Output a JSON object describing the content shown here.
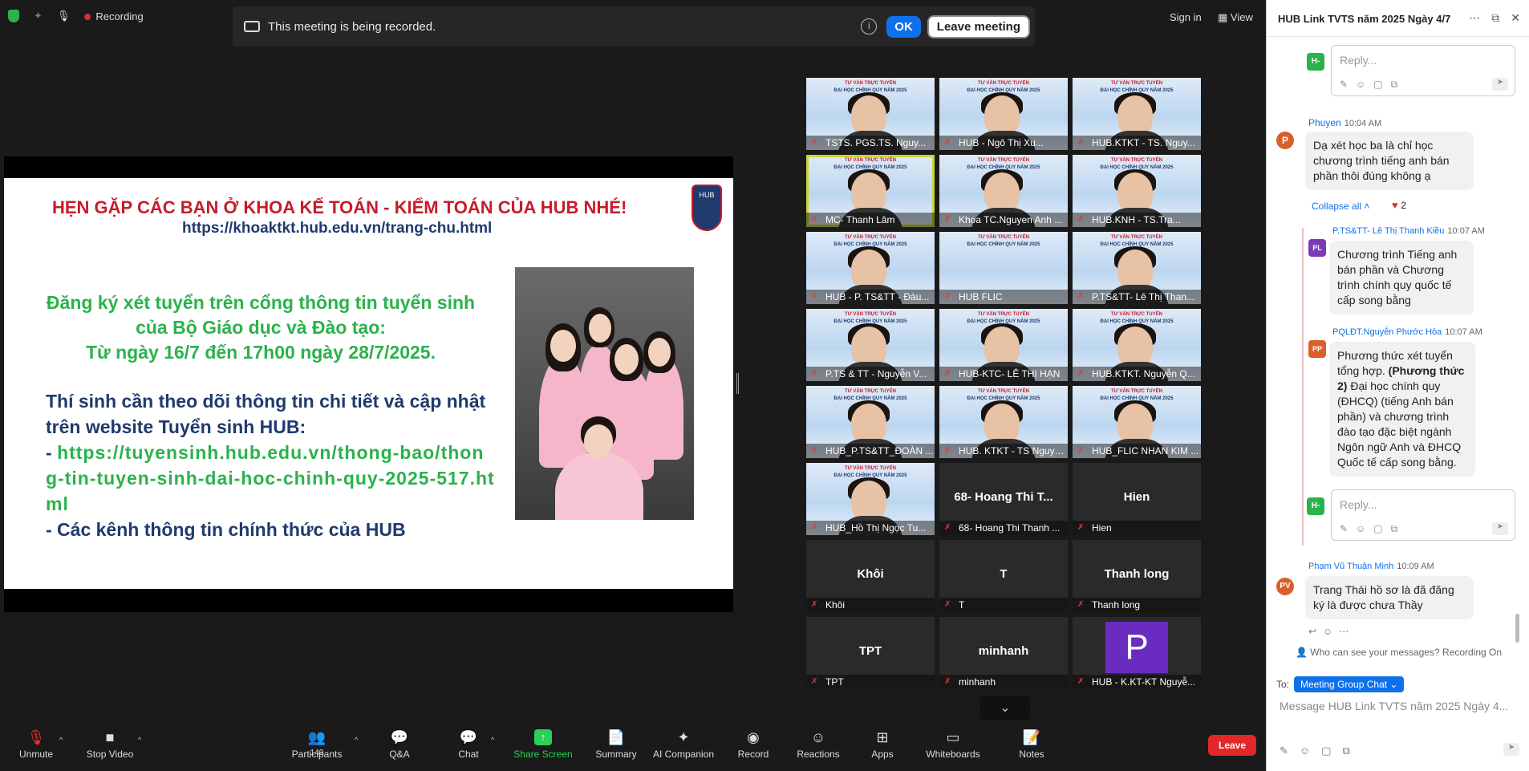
{
  "topbar": {
    "recording_label": "Recording",
    "banner_message": "This meeting is being recorded.",
    "ok_label": "OK",
    "leave_meeting_label": "Leave meeting",
    "signin_label": "Sign in",
    "view_label": "View"
  },
  "slide": {
    "title": "HẸN GẶP CÁC BẠN Ở  KHOA KẾ TOÁN - KIỂM TOÁN CỦA HUB NHÉ!",
    "url": "https://khoaktkt.hub.edu.vn/trang-chu.html",
    "logo_text": "HUB",
    "reg_line1": "Đăng ký xét tuyển trên cổng thông tin tuyển sinh",
    "reg_line2": "của Bộ Giáo dục và Đào tạo:",
    "reg_line3": "Từ ngày 16/7 đến 17h00 ngày 28/7/2025.",
    "note_line1": "Thí sinh cần theo dõi thông tin chi tiết và cập nhật trên website Tuyển sinh HUB:",
    "link_prefix": " - ",
    "link": "https://tuyensinh.hub.edu.vn/thong-bao/thong-tin-tuyen-sinh-dai-hoc-chinh-quy-2025-517.html",
    "note_line3": " - Các kênh thông tin chính thức của HUB"
  },
  "thumb": {
    "head": "TƯ VẤN TRỰC TUYẾN",
    "sub": "ĐẠI HỌC CHÍNH QUY NĂM 2025"
  },
  "gallery": [
    {
      "name": "TSTS. PGS.TS. Nguy...",
      "type": "video",
      "active": false
    },
    {
      "name": "HUB - Ngô Thị Xu...",
      "type": "video",
      "active": false
    },
    {
      "name": "HUB.KTKT - TS. Nguy...",
      "type": "video",
      "active": false
    },
    {
      "name": "MC- Thanh Lâm",
      "type": "video",
      "active": true
    },
    {
      "name": "Khoa TC.Nguyen Anh ...",
      "type": "video",
      "active": false
    },
    {
      "name": "HUB.KNH - TS.Tra...",
      "type": "video",
      "active": false
    },
    {
      "name": "HUB - P. TS&TT - Đàu...",
      "type": "video",
      "active": false
    },
    {
      "name": "HUB FLIC",
      "type": "video",
      "active": false
    },
    {
      "name": "P.TS&TT- Lê Thị Than...",
      "type": "video",
      "active": false
    },
    {
      "name": "P.TS & TT - Nguyễn V...",
      "type": "video",
      "active": false
    },
    {
      "name": "HUB-KTC- LÊ THỊ HẠN",
      "type": "video",
      "active": false
    },
    {
      "name": "HUB.KTKT. Nguyễn Q...",
      "type": "video",
      "active": false
    },
    {
      "name": "HUB_P.TS&TT_ĐOÀN ...",
      "type": "video",
      "active": false
    },
    {
      "name": "HUB. KTKT - TS Nguyen ...",
      "type": "video",
      "active": false
    },
    {
      "name": "HUB_FLIC NHAN KIM ...",
      "type": "video",
      "active": false
    },
    {
      "name": "HUB_Hồ Thị Ngọc Tu...",
      "type": "video",
      "active": false
    },
    {
      "name": "68- Hoang Thi Thanh ...",
      "type": "name",
      "big": "68- Hoang Thi T...",
      "active": false
    },
    {
      "name": "Hien",
      "type": "name",
      "big": "Hien",
      "active": false
    },
    {
      "name": "Khôi",
      "type": "name",
      "big": "Khôi",
      "active": false
    },
    {
      "name": "T",
      "type": "name",
      "big": "T",
      "active": false
    },
    {
      "name": "Thanh long",
      "type": "name",
      "big": "Thanh long",
      "active": false
    },
    {
      "name": "TPT",
      "type": "name",
      "big": "TPT",
      "active": false
    },
    {
      "name": "minhanh",
      "type": "name",
      "big": "minhanh",
      "active": false
    },
    {
      "name": "HUB - K.KT-KT Nguyễ...",
      "type": "avatar",
      "big": "P",
      "active": false
    }
  ],
  "toolbar": {
    "unmute": "Unmute",
    "stop_video": "Stop Video",
    "participants": "Participants",
    "participants_count": "149",
    "qa": "Q&A",
    "chat": "Chat",
    "share_screen": "Share Screen",
    "summary": "Summary",
    "ai_companion": "AI Companion",
    "record": "Record",
    "reactions": "Reactions",
    "apps": "Apps",
    "whiteboards": "Whiteboards",
    "notes": "Notes",
    "leave": "Leave"
  },
  "chat": {
    "title": "HUB Link TVTS năm 2025 Ngày 4/7",
    "reply_placeholder": "Reply...",
    "messages": {
      "phuyen": {
        "initial": "P",
        "sender": "Phuyen",
        "time": "10:04 AM",
        "text": "Dạ xét học ba là chỉ học chương trình tiếng anh bán phần thôi đúng không ạ"
      },
      "collapse": "Collapse all",
      "heart_count": "2",
      "le_thi": {
        "initial": "PL",
        "sender": "P.TS&TT- Lê Thị Thanh Kiều",
        "time": "10:07 AM",
        "text": "Chương trình Tiếng anh bán phần và Chương trình chính quy quốc tế cấp song bằng"
      },
      "pqldt": {
        "initial": "PP",
        "sender": "PQLĐT.Nguyễn Phước Hòa",
        "time": "10:07 AM",
        "text_pre": "Phương thức xét tuyển tổng hợp. ",
        "text_bold": "(Phương thức 2)",
        "text_post": " Đại học chính quy (ĐHCQ) (tiếng Anh bán phần) và chương trình đào tạo đặc biệt ngành Ngôn ngữ Anh và ĐHCQ Quốc tế cấp song bằng."
      },
      "pham": {
        "initial": "PV",
        "sender": "Phạm Vũ Thuận Minh",
        "time": "10:09 AM",
        "text": "Trang Thái hồ sơ là đã đăng ký là được chưa Thầy"
      }
    },
    "who_can_see": "Who can see your messages? Recording On",
    "to_label": "To:",
    "to_value": "Meeting Group Chat",
    "input_placeholder": "Message HUB Link TVTS năm 2025 Ngày 4..."
  },
  "colors": {
    "accent": "#0e71eb",
    "leave": "#e02828",
    "share": "#2bd05a"
  }
}
